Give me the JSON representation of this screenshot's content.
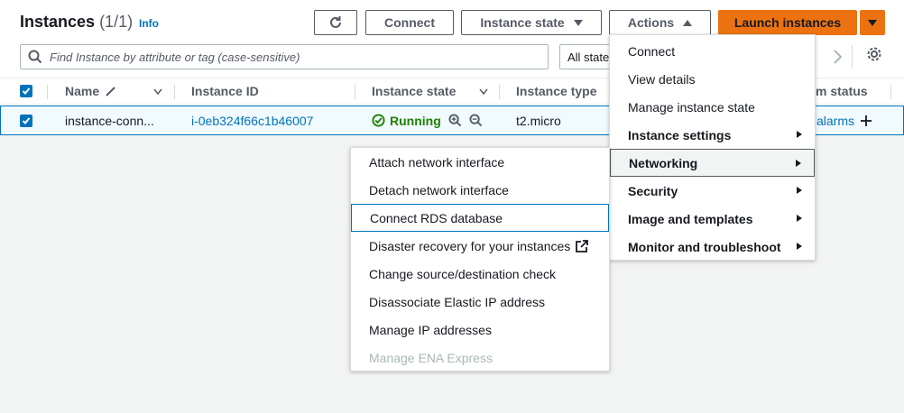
{
  "header": {
    "title": "Instances",
    "count": "(1/1)",
    "info_label": "Info"
  },
  "toolbar": {
    "connect_label": "Connect",
    "instance_state_label": "Instance state",
    "actions_label": "Actions",
    "launch_label": "Launch instances"
  },
  "search": {
    "placeholder": "Find Instance by attribute or tag (case-sensitive)",
    "filter_value": "All states"
  },
  "table": {
    "columns": [
      "Name",
      "Instance ID",
      "Instance state",
      "Instance type",
      "Alarm status"
    ],
    "visible_alarm_header": "m status",
    "row": {
      "name": "instance-conn...",
      "instance_id": "i-0eb324f66c1b46007",
      "state": "Running",
      "type": "t2.micro",
      "alarm_text": "alarms"
    }
  },
  "actions_menu": {
    "items": [
      {
        "label": "Connect",
        "bold": false,
        "submenu": false
      },
      {
        "label": "View details",
        "bold": false,
        "submenu": false
      },
      {
        "label": "Manage instance state",
        "bold": false,
        "submenu": false
      },
      {
        "label": "Instance settings",
        "bold": true,
        "submenu": true
      },
      {
        "label": "Networking",
        "bold": true,
        "submenu": true
      },
      {
        "label": "Security",
        "bold": true,
        "submenu": true
      },
      {
        "label": "Image and templates",
        "bold": true,
        "submenu": true
      },
      {
        "label": "Monitor and troubleshoot",
        "bold": true,
        "submenu": true
      }
    ]
  },
  "networking_submenu": {
    "items": [
      {
        "label": "Attach network interface"
      },
      {
        "label": "Detach network interface"
      },
      {
        "label": "Connect RDS database"
      },
      {
        "label": "Disaster recovery for your instances",
        "external": true
      },
      {
        "label": "Change source/destination check"
      },
      {
        "label": "Disassociate Elastic IP address"
      },
      {
        "label": "Manage IP addresses"
      },
      {
        "label": "Manage ENA Express",
        "disabled": true
      }
    ]
  },
  "colors": {
    "accent": "#0073bb",
    "primary": "#ec7211",
    "running": "#1d8102"
  }
}
